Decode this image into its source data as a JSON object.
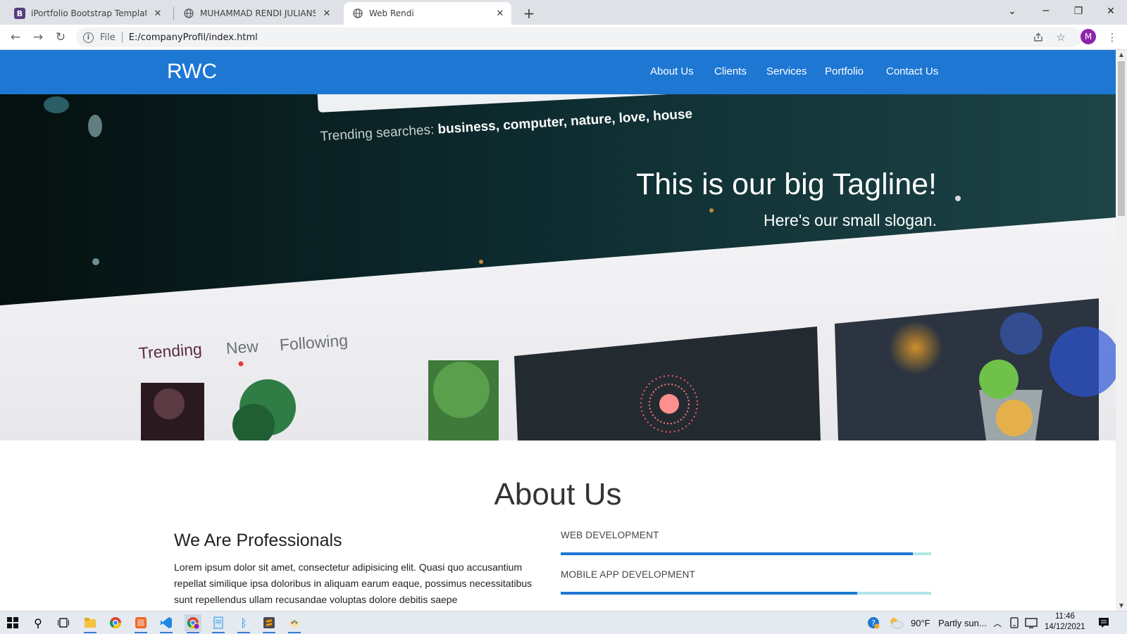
{
  "browser": {
    "tabs": [
      {
        "favicon": "B",
        "title": "iPortfolio Bootstrap Template - In",
        "active": false
      },
      {
        "favicon": "globe-icon",
        "title": "MUHAMMAD RENDI JULIANSYAH",
        "active": false
      },
      {
        "favicon": "globe-icon",
        "title": "Web Rendi",
        "active": true
      }
    ],
    "address": {
      "scheme": "File",
      "url": "E:/companyProfil/index.html"
    },
    "profile_initial": "M"
  },
  "site": {
    "brand": "RWC",
    "nav": [
      "About Us",
      "Clients",
      "Services",
      "Portfolio",
      "Contact Us"
    ],
    "hero": {
      "tagline": "This is our big Tagline!",
      "slogan": "Here's our small slogan.",
      "photo": {
        "trending_prefix": "Trending searches:",
        "trending_terms": "business, computer, nature, love, house",
        "photo_tabs": [
          "Trending",
          "New",
          "Following"
        ]
      }
    },
    "about": {
      "title": "About Us",
      "heading": "We Are Professionals",
      "paragraph": "Lorem ipsum dolor sit amet, consectetur adipisicing elit. Quasi quo accusantium repellat similique ipsa doloribus in aliquam earum eaque, possimus necessitatibus sunt repellendus ullam recusandae voluptas dolore debitis saepe",
      "skills": [
        {
          "label": "WEB DEVELOPMENT",
          "percent": 95
        },
        {
          "label": "MOBILE APP DEVELOPMENT",
          "percent": 80
        }
      ]
    }
  },
  "taskbar": {
    "weather": "90°F",
    "weather_desc": "Partly sun...",
    "time": "11:46",
    "date": "14/12/2021"
  },
  "colors": {
    "nav_blue": "#1e77d3",
    "skill_track": "#b3e5e8",
    "chrome_tabbar": "#dee1e6"
  }
}
